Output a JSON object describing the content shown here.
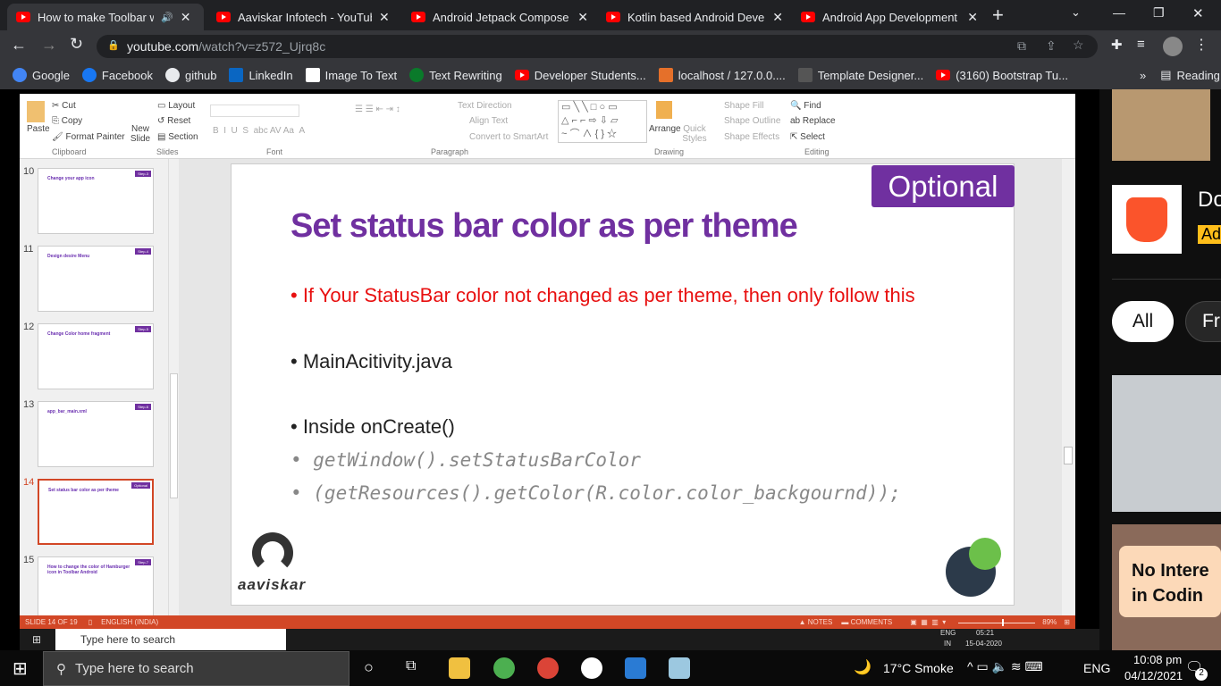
{
  "browser": {
    "tabs": [
      {
        "label": "How to make Toolbar with",
        "active": true
      },
      {
        "label": "Aaviskar Infotech - YouTube"
      },
      {
        "label": "Android Jetpack Compose Tu"
      },
      {
        "label": "Kotlin based Android Develo"
      },
      {
        "label": "Android App Development T"
      }
    ],
    "url_host": "youtube.com",
    "url_path": "/watch?v=z572_Ujrq8c",
    "bookmarks": [
      "Google",
      "Facebook",
      "github",
      "LinkedIn",
      "Image To Text",
      "Text Rewriting",
      "Developer Students...",
      "localhost / 127.0.0....",
      "Template Designer...",
      "(3160) Bootstrap Tu..."
    ],
    "reading_list": "Reading list",
    "bookmark_overflow": "»"
  },
  "ppt": {
    "ribbon": {
      "cut": "Cut",
      "copy": "Copy",
      "format_painter": "Format Painter",
      "paste": "Paste",
      "clipboard": "Clipboard",
      "layout": "Layout",
      "reset": "Reset",
      "section": "Section",
      "new_slide": "New Slide",
      "slides": "Slides",
      "font": "Font",
      "text_direction": "Text Direction",
      "align_text": "Align Text",
      "convert_smartart": "Convert to SmartArt",
      "paragraph": "Paragraph",
      "arrange": "Arrange",
      "quick_styles": "Quick Styles",
      "shape_fill": "Shape Fill",
      "shape_outline": "Shape Outline",
      "shape_effects": "Shape Effects",
      "drawing": "Drawing",
      "find": "Find",
      "replace": "Replace",
      "select": "Select",
      "editing": "Editing"
    },
    "thumbnails": [
      {
        "num": "10",
        "title": "Change your app icon",
        "badge": "Step-3"
      },
      {
        "num": "11",
        "title": "Design desire Menu",
        "badge": "Step-4"
      },
      {
        "num": "12",
        "title": "Change Color home fragment",
        "badge": "Step-5"
      },
      {
        "num": "13",
        "title": "app_bar_main.xml",
        "badge": "Step-6"
      },
      {
        "num": "14",
        "title": "Set status bar color as per theme",
        "badge": "Optional",
        "selected": true
      },
      {
        "num": "15",
        "title": "How to change the color of Hamburger icon in Toolbar Android",
        "badge": "Step-7"
      }
    ],
    "slide": {
      "badge": "Optional",
      "title": "Set status bar color as per theme",
      "bullets": [
        "• If Your StatusBar color not changed as per theme, then only follow this",
        "• MainAcitivity.java",
        "• Inside onCreate()",
        "• getWindow().setStatusBarColor",
        "• (getResources().getColor(R.color.color_backgournd));"
      ],
      "logo_text": "aaviskar"
    },
    "status": {
      "slide": "SLIDE 14 OF 19",
      "language": "ENGLISH (INDIA)",
      "notes": "NOTES",
      "comments": "COMMENTS",
      "zoom": "89%",
      "zoom_level": 89
    },
    "inner_taskbar": {
      "search": "Type here to search",
      "lang": "ENG",
      "lang2": "IN",
      "time": "05:21",
      "date": "15-04-2020"
    }
  },
  "youtube_sidebar": {
    "ad_title": "Do",
    "ad_badge": "Ad",
    "chip_all": "All",
    "chip_next": "Fr",
    "thumb_text": "No Intere in Codin"
  },
  "taskbar": {
    "search": "Type here to search",
    "weather": "17°C  Smoke",
    "lang": "ENG",
    "time": "10:08 pm",
    "date": "04/12/2021",
    "notifications": "2"
  },
  "colors": {
    "accent_ppt": "#d24726",
    "slide_purple": "#7030a0",
    "bullet_red": "#e81010"
  }
}
